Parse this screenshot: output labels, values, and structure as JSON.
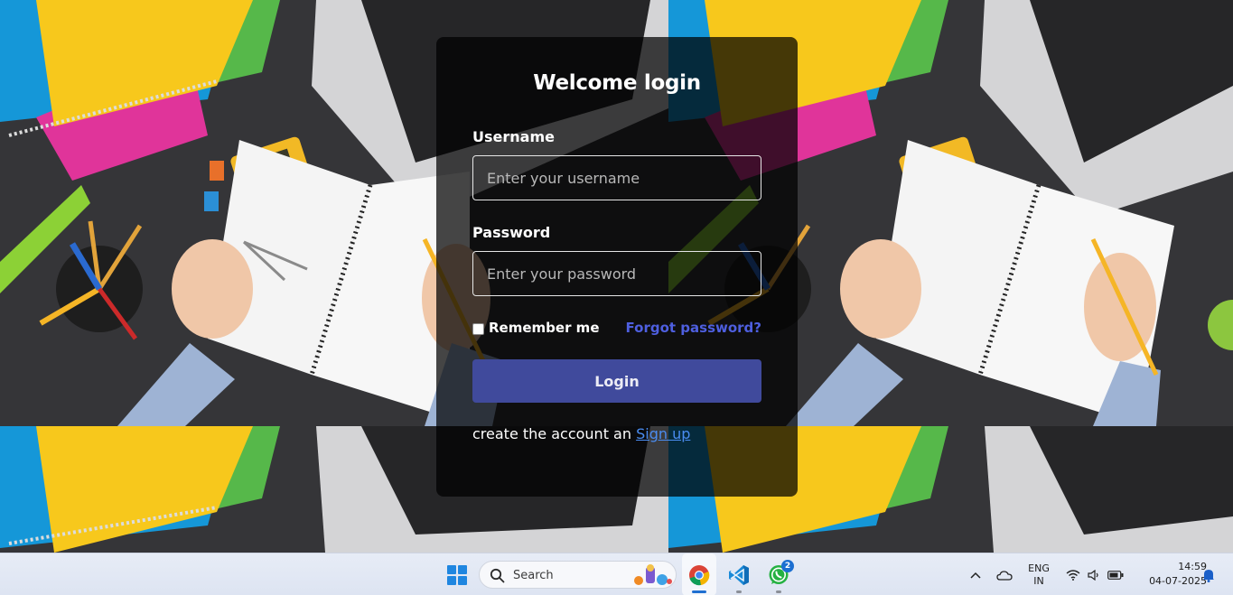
{
  "login": {
    "title": "Welcome login",
    "username_label": "Username",
    "username_placeholder": "Enter your username",
    "password_label": "Password",
    "password_placeholder": "Enter your password",
    "remember_label": "Remember me",
    "forgot_label": "Forgot password?",
    "login_button": "Login",
    "signup_prefix": "create the account an",
    "signup_link": "Sign up"
  },
  "taskbar": {
    "search_placeholder": "Search",
    "apps": [
      {
        "name": "Google Chrome",
        "icon": "chrome-icon",
        "active": true
      },
      {
        "name": "Visual Studio Code",
        "icon": "vscode-icon",
        "active": false
      },
      {
        "name": "WhatsApp",
        "icon": "whatsapp-icon",
        "active": false,
        "badge": "2"
      }
    ],
    "tray": {
      "language_line1": "ENG",
      "language_line2": "IN",
      "icons": [
        "chevron-up-icon",
        "onedrive-cloud-icon",
        "wifi-icon",
        "volume-icon",
        "battery-icon",
        "notification-bell-icon"
      ]
    },
    "clock": {
      "time": "14:59",
      "date": "04-07-2025"
    }
  },
  "colors": {
    "panel_bg": "#000000b8",
    "login_button": "#404a9c",
    "forgot_link": "#4e5fe0",
    "signup_link": "#4a8cf0",
    "taskbar_bg": "#e3e8f4",
    "accent_blue": "#1f86e0"
  }
}
